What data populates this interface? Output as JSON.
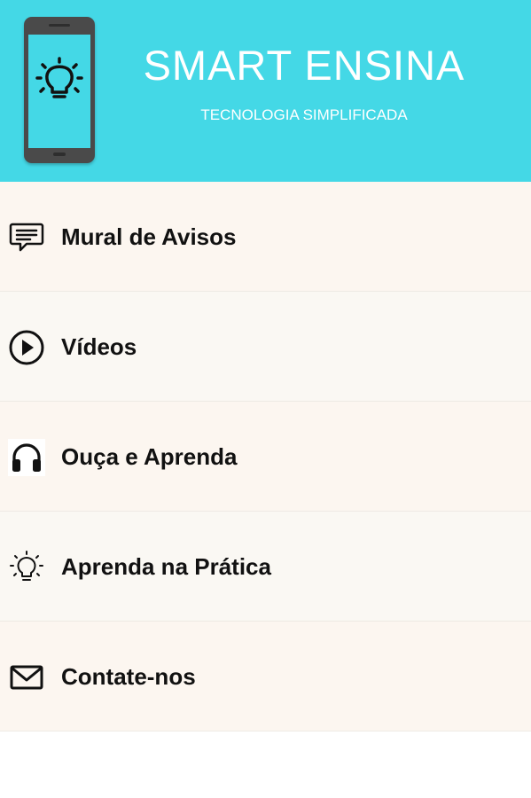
{
  "header": {
    "title": "SMART ENSINA",
    "subtitle": "TECNOLOGIA SIMPLIFICADA",
    "logo_icon": "phone-lightbulb-icon",
    "background_color": "#44d8e6"
  },
  "menu": {
    "items": [
      {
        "label": "Mural de Avisos",
        "icon": "message-icon"
      },
      {
        "label": "Vídeos",
        "icon": "play-circle-icon"
      },
      {
        "label": "Ouça e Aprenda",
        "icon": "headphones-icon"
      },
      {
        "label": "Aprenda na Prática",
        "icon": "lightbulb-icon"
      },
      {
        "label": "Contate-nos",
        "icon": "mail-icon"
      }
    ]
  }
}
